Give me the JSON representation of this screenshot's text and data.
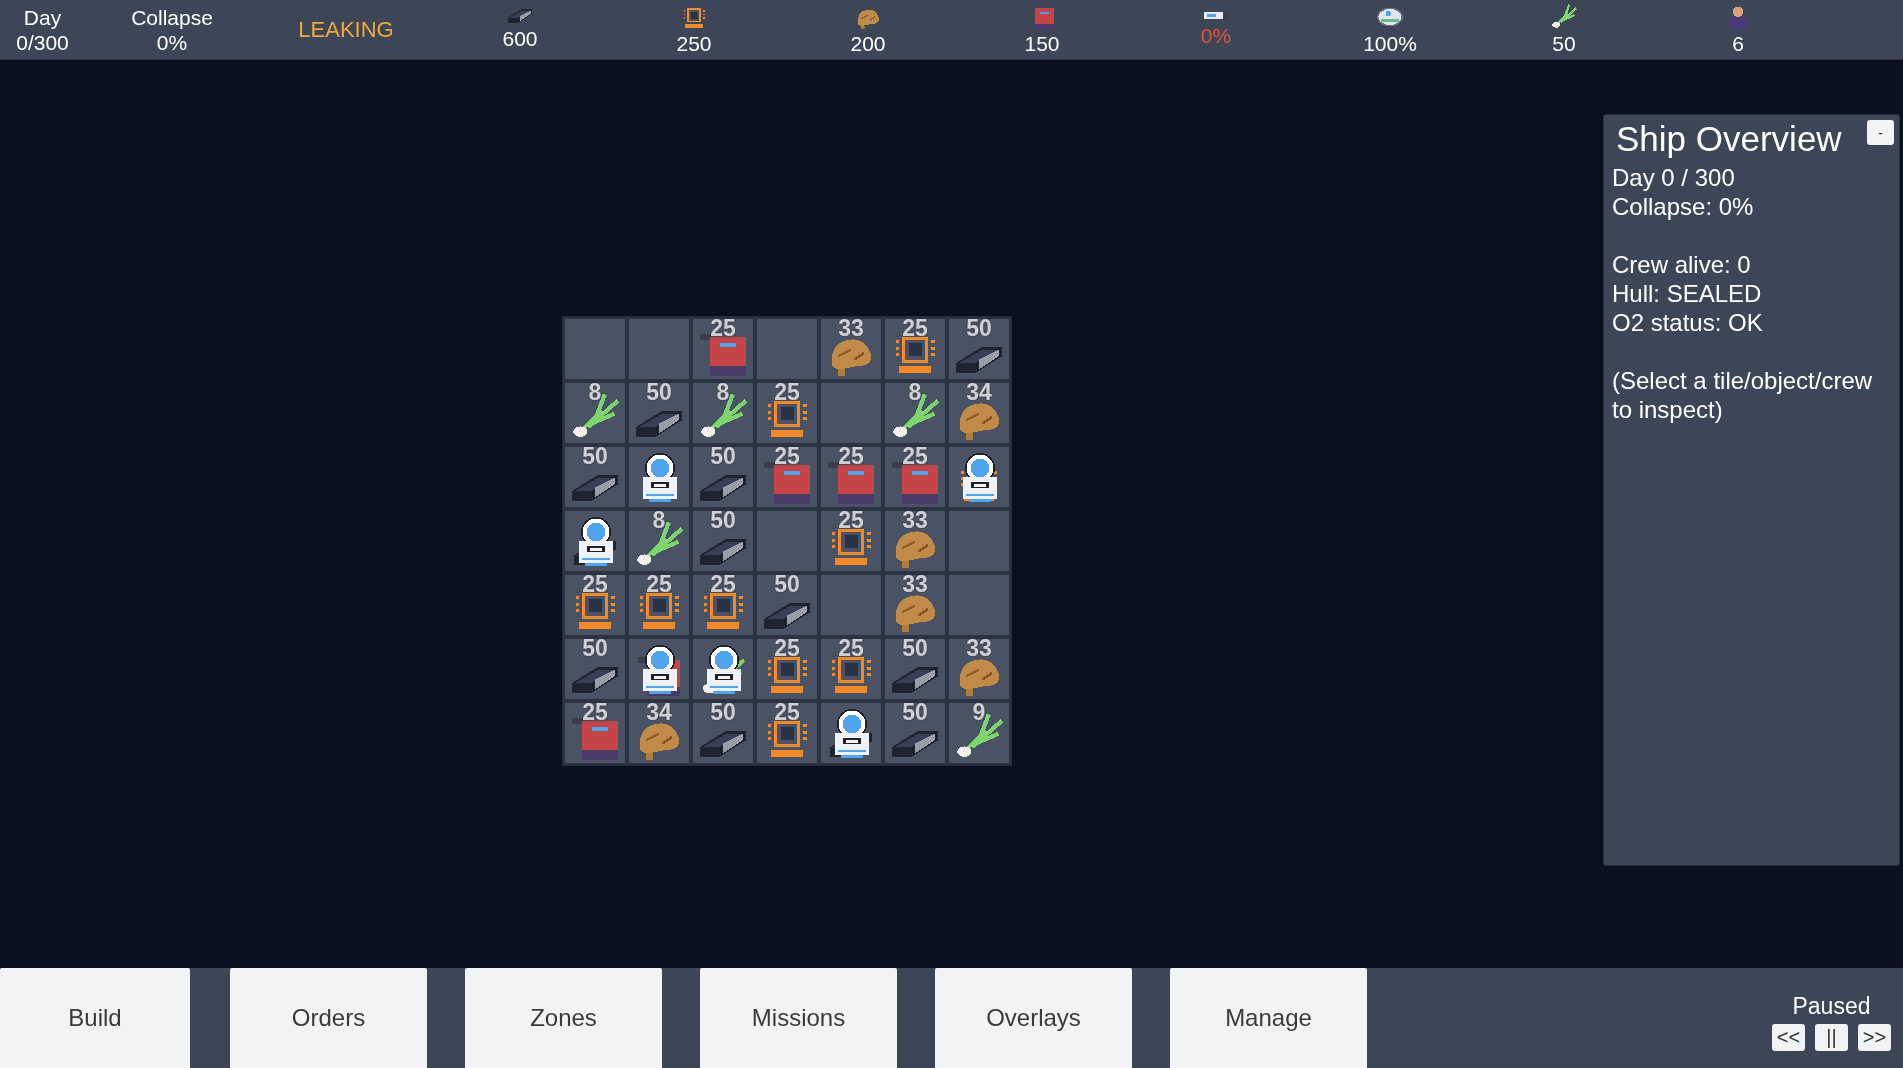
{
  "top_bar": {
    "day": {
      "label": "Day",
      "value": "0/300"
    },
    "collapse": {
      "label": "Collapse",
      "value": "0%"
    },
    "status": {
      "kind": "warning",
      "text": "LEAKING"
    },
    "resources": [
      {
        "kind": "metal",
        "value": "600",
        "alert": false
      },
      {
        "kind": "chip",
        "value": "250",
        "alert": false
      },
      {
        "kind": "food",
        "value": "200",
        "alert": false
      },
      {
        "kind": "fuel",
        "value": "150",
        "alert": false
      },
      {
        "kind": "tank",
        "value": "0%",
        "alert": true
      },
      {
        "kind": "oxygen",
        "value": "100%",
        "alert": false
      },
      {
        "kind": "leek",
        "value": "50",
        "alert": false
      },
      {
        "kind": "person",
        "value": "6",
        "alert": false
      }
    ]
  },
  "grid": [
    [
      {
        "kind": "empty",
        "crew": false
      },
      {
        "kind": "empty",
        "crew": false
      },
      {
        "kind": "fuel",
        "count": "25",
        "crew": false
      },
      {
        "kind": "empty",
        "crew": false
      },
      {
        "kind": "food",
        "count": "33",
        "crew": false
      },
      {
        "kind": "chip",
        "count": "25",
        "crew": false
      },
      {
        "kind": "metal",
        "count": "50",
        "crew": false
      }
    ],
    [
      {
        "kind": "leek",
        "count": "8",
        "crew": false
      },
      {
        "kind": "metal",
        "count": "50",
        "crew": false
      },
      {
        "kind": "leek",
        "count": "8",
        "crew": false
      },
      {
        "kind": "chip",
        "count": "25",
        "crew": false
      },
      {
        "kind": "empty",
        "crew": false
      },
      {
        "kind": "leek",
        "count": "8",
        "crew": false
      },
      {
        "kind": "food",
        "count": "34",
        "crew": false
      }
    ],
    [
      {
        "kind": "metal",
        "count": "50",
        "crew": false
      },
      {
        "kind": "empty",
        "crew": true
      },
      {
        "kind": "metal",
        "count": "50",
        "crew": false
      },
      {
        "kind": "fuel",
        "count": "25",
        "crew": false
      },
      {
        "kind": "fuel",
        "count": "25",
        "crew": false
      },
      {
        "kind": "fuel",
        "count": "25",
        "crew": false
      },
      {
        "kind": "chip",
        "crew": true
      }
    ],
    [
      {
        "kind": "metal",
        "crew": true
      },
      {
        "kind": "leek",
        "count": "8",
        "crew": false
      },
      {
        "kind": "metal",
        "count": "50",
        "crew": false
      },
      {
        "kind": "empty",
        "crew": false
      },
      {
        "kind": "chip",
        "count": "25",
        "crew": false
      },
      {
        "kind": "food",
        "count": "33",
        "crew": false
      },
      {
        "kind": "empty",
        "crew": false
      }
    ],
    [
      {
        "kind": "chip",
        "count": "25",
        "crew": false
      },
      {
        "kind": "chip",
        "count": "25",
        "crew": false
      },
      {
        "kind": "chip",
        "count": "25",
        "crew": false
      },
      {
        "kind": "metal",
        "count": "50",
        "crew": false
      },
      {
        "kind": "empty",
        "crew": false
      },
      {
        "kind": "food",
        "count": "33",
        "crew": false
      },
      {
        "kind": "empty",
        "crew": false
      }
    ],
    [
      {
        "kind": "metal",
        "count": "50",
        "crew": false
      },
      {
        "kind": "fuel",
        "crew": true
      },
      {
        "kind": "leek",
        "crew": true
      },
      {
        "kind": "chip",
        "count": "25",
        "crew": false
      },
      {
        "kind": "chip",
        "count": "25",
        "crew": false
      },
      {
        "kind": "metal",
        "count": "50",
        "crew": false
      },
      {
        "kind": "food",
        "count": "33",
        "crew": false
      }
    ],
    [
      {
        "kind": "fuel",
        "count": "25",
        "crew": false
      },
      {
        "kind": "food",
        "count": "34",
        "crew": false
      },
      {
        "kind": "metal",
        "count": "50",
        "crew": false
      },
      {
        "kind": "chip",
        "count": "25",
        "crew": false
      },
      {
        "kind": "metal",
        "crew": true
      },
      {
        "kind": "metal",
        "count": "50",
        "crew": false
      },
      {
        "kind": "leek",
        "count": "9",
        "crew": false
      }
    ]
  ],
  "overview_panel": {
    "title": "Ship Overview",
    "minimize_button": "-",
    "sections": [
      [
        "Day 0 / 300",
        "Collapse: 0%"
      ],
      [
        "Crew alive: 0",
        "Hull: SEALED",
        "O2 status: OK"
      ],
      [
        "(Select a tile/object/crew to inspect)"
      ]
    ]
  },
  "bottom_bar": {
    "tabs": [
      "Build",
      "Orders",
      "Zones",
      "Missions",
      "Overlays",
      "Manage"
    ],
    "speed": {
      "status": "Paused",
      "controls": [
        "<<",
        "||",
        ">>"
      ]
    }
  }
}
